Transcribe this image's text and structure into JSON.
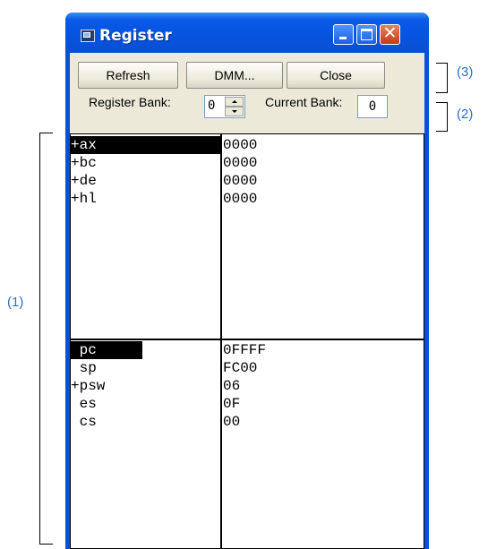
{
  "window": {
    "title": "Register"
  },
  "buttons": {
    "refresh": "Refresh",
    "dmm": "DMM...",
    "close": "Close"
  },
  "bank": {
    "register_bank_label": "Register Bank:",
    "register_bank_value": "0",
    "current_bank_label": "Current Bank:",
    "current_bank_value": "0"
  },
  "general_registers": [
    {
      "name": "+ax",
      "value": "0000",
      "selected": true
    },
    {
      "name": "+bc",
      "value": "0000",
      "selected": false
    },
    {
      "name": "+de",
      "value": "0000",
      "selected": false
    },
    {
      "name": "+hl",
      "value": "0000",
      "selected": false
    }
  ],
  "control_registers": [
    {
      "name": " pc",
      "value": "0FFFF",
      "selected": true
    },
    {
      "name": " sp",
      "value": "FC00",
      "selected": false
    },
    {
      "name": "+psw",
      "value": "06",
      "selected": false
    },
    {
      "name": " es",
      "value": "0F",
      "selected": false
    },
    {
      "name": " cs",
      "value": "00",
      "selected": false
    }
  ],
  "annotations": {
    "a1": "(1)",
    "a2": "(2)",
    "a3": "(3)"
  },
  "colors": {
    "title_bar": "#0a5ae8",
    "annotation": "#2a6fc9",
    "dialog_bg": "#ece9d8"
  }
}
